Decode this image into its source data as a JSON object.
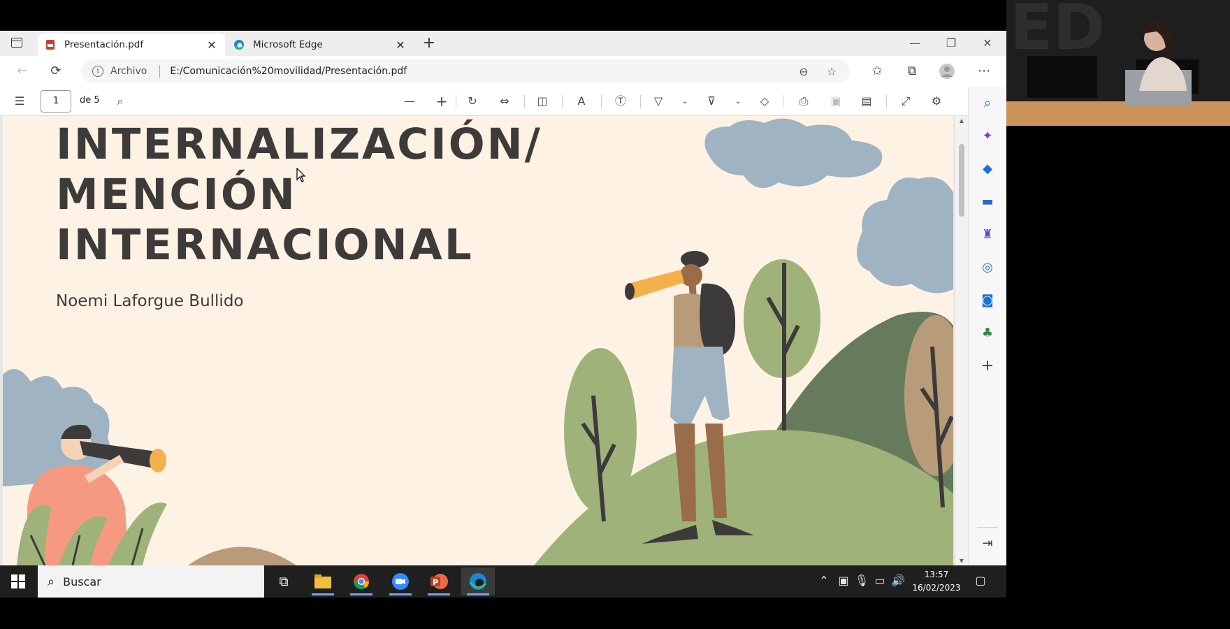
{
  "browser": {
    "tabs": [
      {
        "title": "Presentación.pdf",
        "active": true,
        "icon": "pdf-file-icon"
      },
      {
        "title": "Microsoft Edge",
        "active": false,
        "icon": "edge-logo-icon"
      }
    ],
    "address": {
      "site_label": "Archivo",
      "url": "E:/Comunicación%20movilidad/Presentación.pdf"
    }
  },
  "pdf_toolbar": {
    "page_current": "1",
    "page_total_label": "de 5"
  },
  "pdf_page": {
    "title_lines": [
      "INTERNALIZACIÓN/",
      "MENCIÓN",
      "INTERNACIONAL"
    ],
    "author": "Noemi Laforgue Bullido",
    "colors": {
      "background": "#fdf2e4",
      "text": "#3d3b3a",
      "green_light": "#9fb27a",
      "green_dark": "#667a5c",
      "blue_cloud": "#9fb3c2",
      "tan": "#b89b78"
    }
  },
  "taskbar": {
    "search_label": "Buscar",
    "time": "13:57",
    "date": "16/02/2023"
  }
}
